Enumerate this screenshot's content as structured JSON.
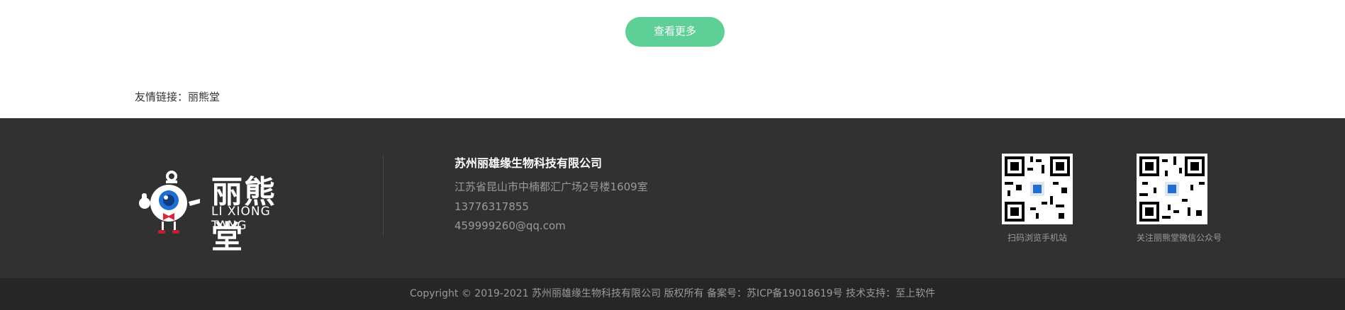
{
  "main": {
    "more_label": "查看更多"
  },
  "friend_links": {
    "label": "友情链接：",
    "links": [
      {
        "text": "丽熊堂"
      }
    ]
  },
  "footer": {
    "logo": {
      "text_cn": "丽熊堂",
      "text_en": "LI XIONG TANG"
    },
    "company": {
      "name": "苏州丽雄缘生物科技有限公司",
      "address": "江苏省昆山市中楠都汇广场2号楼1609室",
      "phone": "13776317855",
      "email": "459999260@qq.com"
    },
    "qr_codes": [
      {
        "caption": "扫码浏览手机站"
      },
      {
        "caption": "关注丽熊堂微信公众号"
      }
    ]
  },
  "copyright": {
    "text": "Copyright © 2019-2021 苏州丽雄缘生物科技有限公司 版权所有   备案号：苏ICP备19018619号   技术支持：至上软件"
  }
}
